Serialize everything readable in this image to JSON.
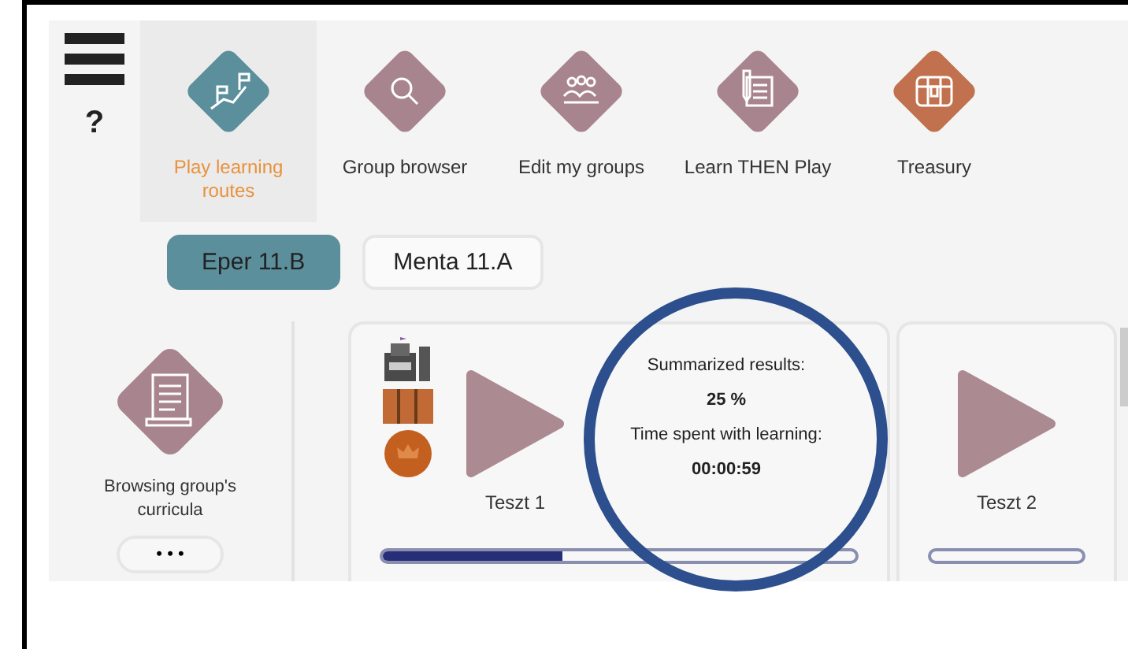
{
  "help": "?",
  "modules": [
    {
      "label": "Play learning routes",
      "selected": true,
      "color": "#5b8f9c"
    },
    {
      "label": "Group browser",
      "selected": false,
      "color": "#a8858e"
    },
    {
      "label": "Edit my groups",
      "selected": false,
      "color": "#a8858e"
    },
    {
      "label": "Learn THEN Play",
      "selected": false,
      "color": "#a8858e"
    },
    {
      "label": "Treasury",
      "selected": false,
      "color": "#c1714e"
    }
  ],
  "groups": [
    {
      "label": "Eper 11.B",
      "selected": true
    },
    {
      "label": "Menta 11.A",
      "selected": false
    }
  ],
  "sidebar": {
    "label": "Browsing group's curricula",
    "more": "• • •"
  },
  "cards": [
    {
      "kind": "results",
      "title": "Teszt 1",
      "level": 0.38,
      "results_label": "Summarized results:",
      "results": "25 %",
      "time_label": "Time spent with learning:",
      "time": "00:00:59"
    },
    {
      "kind": "plain",
      "title": "Teszt 2",
      "level": 0
    }
  ]
}
